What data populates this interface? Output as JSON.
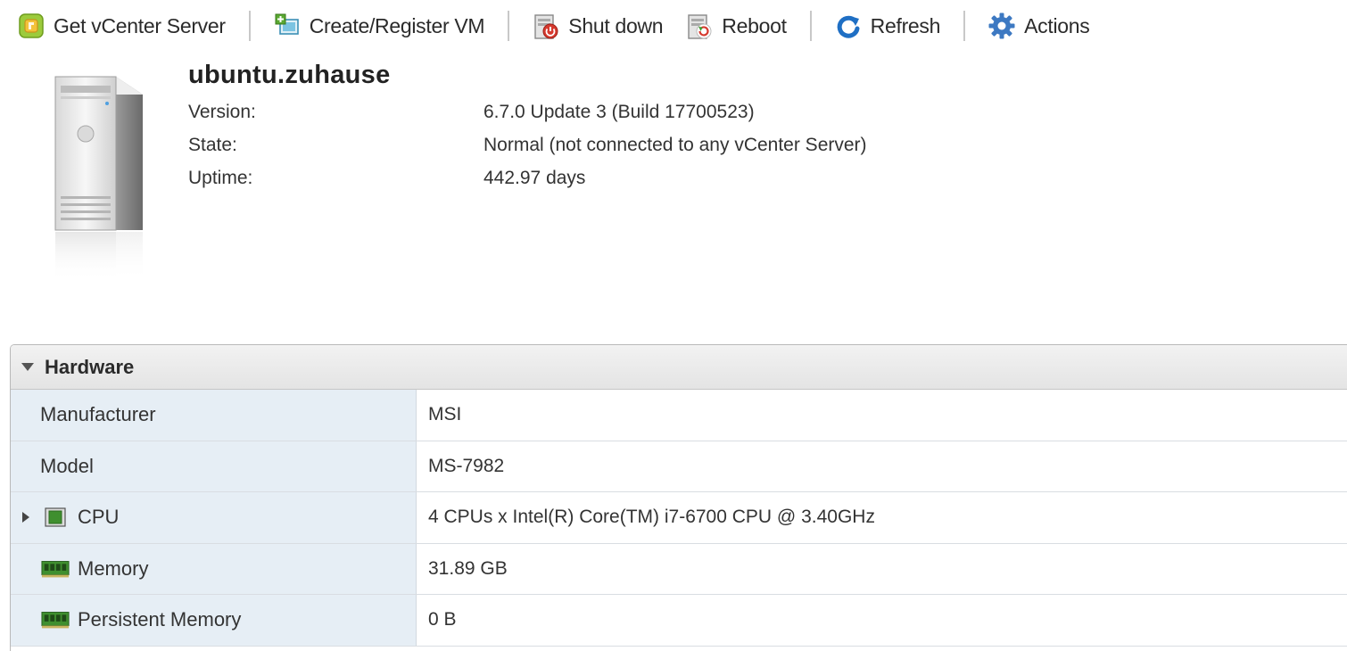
{
  "toolbar": {
    "get_vcenter": "Get vCenter Server",
    "create_register": "Create/Register VM",
    "shut_down": "Shut down",
    "reboot": "Reboot",
    "refresh": "Refresh",
    "actions": "Actions"
  },
  "host": {
    "name": "ubuntu.zuhause",
    "icon": "server-tower-icon",
    "info": [
      {
        "label": "Version:",
        "value": "6.7.0 Update 3 (Build 17700523)"
      },
      {
        "label": "State:",
        "value": "Normal (not connected to any vCenter Server)"
      },
      {
        "label": "Uptime:",
        "value": "442.97 days"
      }
    ]
  },
  "hardware": {
    "title": "Hardware",
    "rows": [
      {
        "label": "Manufacturer",
        "value": "MSI"
      },
      {
        "label": "Model",
        "value": "MS-7982"
      },
      {
        "label": "CPU",
        "value": "4 CPUs x Intel(R) Core(TM) i7-6700 CPU @ 3.40GHz",
        "icon": "cpu-chip-icon",
        "expandable": true
      },
      {
        "label": "Memory",
        "value": "31.89 GB",
        "icon": "memory-module-icon"
      },
      {
        "label": "Persistent Memory",
        "value": "0 B",
        "icon": "memory-module-icon"
      }
    ]
  },
  "colors": {
    "accent_blue": "#1f6fc4",
    "key_column_bg": "#e6eef5",
    "icon_green": "#3f8f2f"
  }
}
